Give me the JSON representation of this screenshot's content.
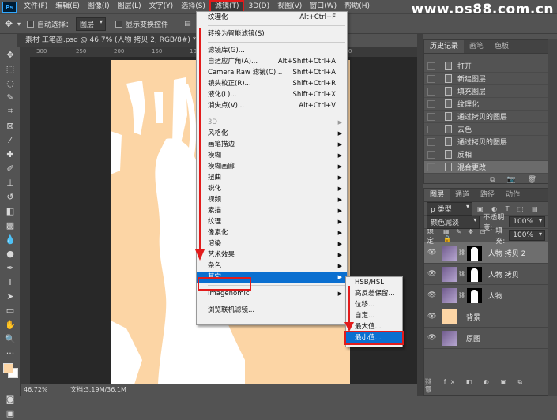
{
  "app": {
    "logo": "Ps"
  },
  "watermark": "www.ps88.com.cn",
  "menubar": [
    "文件(F)",
    "编辑(E)",
    "图像(I)",
    "图层(L)",
    "文字(Y)",
    "选择(S)",
    "滤镜(T)",
    "3D(D)",
    "视图(V)",
    "窗口(W)",
    "帮助(H)"
  ],
  "options": {
    "auto_select_label": "自动选择：",
    "auto_select_value": "图层",
    "show_transform_label": "显示变换控件"
  },
  "document": {
    "tab_title": "素材 工笔画.psd @ 46.7% (人物 拷贝 2, RGB/8#) *",
    "zoom": "46.72%",
    "doc_size": "文档:3.19M/36.1M"
  },
  "ruler_ticks": [
    "300",
    "250",
    "200",
    "150",
    "100",
    "50",
    "0",
    "50",
    "100"
  ],
  "filter_menu": {
    "items": [
      {
        "label": "纹理化",
        "shortcut": "Alt+Ctrl+F"
      },
      {
        "sep": true
      },
      {
        "label": "转换为智能滤镜(S)"
      },
      {
        "sep": true
      },
      {
        "label": "滤镜库(G)..."
      },
      {
        "label": "自适应广角(A)...",
        "shortcut": "Alt+Shift+Ctrl+A"
      },
      {
        "label": "Camera Raw 滤镜(C)...",
        "shortcut": "Shift+Ctrl+A"
      },
      {
        "label": "镜头校正(R)...",
        "shortcut": "Shift+Ctrl+R"
      },
      {
        "label": "液化(L)...",
        "shortcut": "Shift+Ctrl+X"
      },
      {
        "label": "消失点(V)...",
        "shortcut": "Alt+Ctrl+V"
      },
      {
        "sep": true
      },
      {
        "label": "3D",
        "sub": true,
        "disabled": true
      },
      {
        "label": "风格化",
        "sub": true
      },
      {
        "label": "画笔描边",
        "sub": true
      },
      {
        "label": "模糊",
        "sub": true
      },
      {
        "label": "模糊画廊",
        "sub": true
      },
      {
        "label": "扭曲",
        "sub": true
      },
      {
        "label": "锐化",
        "sub": true
      },
      {
        "label": "视频",
        "sub": true
      },
      {
        "label": "素描",
        "sub": true
      },
      {
        "label": "纹理",
        "sub": true
      },
      {
        "label": "像素化",
        "sub": true
      },
      {
        "label": "渲染",
        "sub": true
      },
      {
        "label": "艺术效果",
        "sub": true
      },
      {
        "label": "杂色",
        "sub": true
      },
      {
        "label": "其它",
        "sub": true,
        "highlight": true
      },
      {
        "sep": true
      },
      {
        "label": "Imagenomic",
        "sub": true
      },
      {
        "sep": true
      },
      {
        "label": "浏览联机滤镜..."
      }
    ]
  },
  "submenu": {
    "items": [
      {
        "label": "HSB/HSL"
      },
      {
        "label": "高反差保留..."
      },
      {
        "label": "位移..."
      },
      {
        "label": "自定..."
      },
      {
        "label": "最大值..."
      },
      {
        "label": "最小值...",
        "highlight": true
      }
    ]
  },
  "history_panel": {
    "tabs": [
      "历史记录",
      "画笔",
      "色板"
    ],
    "items": [
      "打开",
      "新建图层",
      "填充图层",
      "纹理化",
      "通过拷贝的图层",
      "去色",
      "通过拷贝的图层",
      "反相",
      "混合更改"
    ]
  },
  "layers_panel": {
    "tabs": [
      "图层",
      "通道",
      "路径",
      "动作"
    ],
    "kind_label": "ρ 类型",
    "blend_mode": "颜色减淡",
    "opacity_label": "不透明度:",
    "opacity_value": "100%",
    "lock_label": "锁定:",
    "fill_label": "填充:",
    "fill_value": "100%",
    "layers": [
      {
        "name": "人物 拷贝 2",
        "mask": true,
        "current": true
      },
      {
        "name": "人物 拷贝",
        "mask": true
      },
      {
        "name": "人物",
        "mask": true
      },
      {
        "name": "背景",
        "mask": false,
        "color": "#fcd5a5"
      },
      {
        "name": "原图",
        "mask": false
      }
    ]
  },
  "colors": {
    "accent_red": "#e21b1b",
    "highlight_blue": "#0a6fd0",
    "canvas_peach": "#fcd5a5"
  }
}
